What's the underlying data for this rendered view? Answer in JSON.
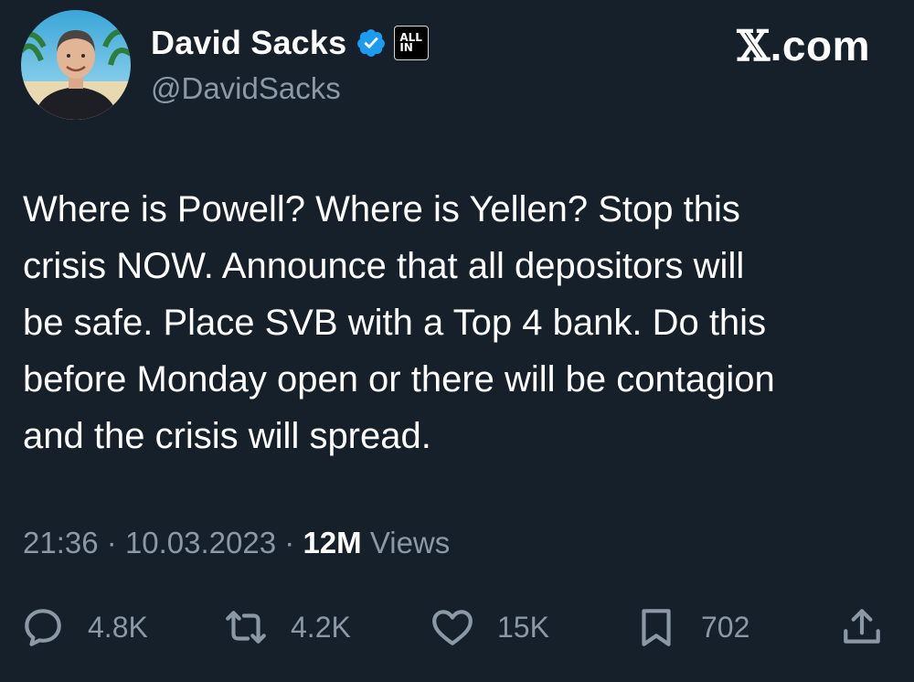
{
  "author": {
    "display_name": "David Sacks",
    "handle": "@DavidSacks",
    "affiliation_badge": [
      "ALL",
      "IN"
    ],
    "verified_color": "#1d9bf0"
  },
  "site_logo": {
    "glyph": "𝕏",
    "suffix": ".com"
  },
  "tweet": {
    "text": "Where is Powell? Where is Yellen? Stop this\ncrisis NOW. Announce that all depositors will\nbe safe. Place SVB with a Top 4 bank. Do this\nbefore Monday open or there will be contagion\nand the crisis will spread.",
    "time": "21:36",
    "separator": "·",
    "date": "10.03.2023",
    "views_count": "12M",
    "views_label": "Views"
  },
  "actions": {
    "replies": {
      "icon": "reply-icon",
      "count": "4.8K"
    },
    "reposts": {
      "icon": "repost-icon",
      "count": "4.2K"
    },
    "likes": {
      "icon": "like-icon",
      "count": "15K"
    },
    "bookmarks": {
      "icon": "bookmark-icon",
      "count": "702"
    },
    "share": {
      "icon": "share-icon"
    }
  },
  "colors": {
    "background": "#15202b",
    "text_primary": "#ffffff",
    "text_secondary": "#8b98a5",
    "accent": "#1d9bf0"
  }
}
